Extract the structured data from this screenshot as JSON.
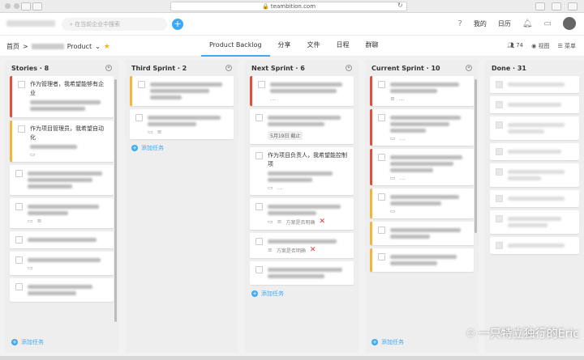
{
  "browser": {
    "url": "teambition.com"
  },
  "header": {
    "search_placeholder": "在当前企业中搜索",
    "mine_label": "我的",
    "calendar_label": "日历",
    "bell_icon": "bell-icon",
    "chat_icon": "chat-icon"
  },
  "project_nav": {
    "home_label": "首页",
    "separator": ">",
    "project_label": "Product",
    "tabs": [
      {
        "label": "Product Backlog",
        "active": true
      },
      {
        "label": "分享",
        "active": false
      },
      {
        "label": "文件",
        "active": false
      },
      {
        "label": "日程",
        "active": false
      },
      {
        "label": "群聊",
        "active": false
      }
    ],
    "members_count": "74",
    "view_label": "视图",
    "menu_label": "菜单"
  },
  "columns": [
    {
      "title": "Stories · 8",
      "cards": [
        {
          "color": "red",
          "text": "作为管理者，我希望能够有企业",
          "blur_lines": 2
        },
        {
          "color": "yellow",
          "text": "作为项目管理员，我希望自动化",
          "blur_lines": 1
        }
      ],
      "add_label": "添加任务"
    },
    {
      "title": "Third Sprint · 2",
      "cards": [],
      "add_label": "添加任务"
    },
    {
      "title": "Next Sprint · 6",
      "cards": [
        {
          "date": "5月19日 截止"
        },
        {
          "text": "作为项目负责人，我希望能控制项"
        },
        {
          "meta_text": "方案是否明确"
        },
        {
          "meta_text": "方案是否明确"
        }
      ],
      "add_label": "添加任务"
    },
    {
      "title": "Current Sprint · 10",
      "cards": [],
      "add_label": "添加任务"
    },
    {
      "title": "Done · 31",
      "cards": []
    }
  ],
  "watermark": "一只特立独行的Eric"
}
